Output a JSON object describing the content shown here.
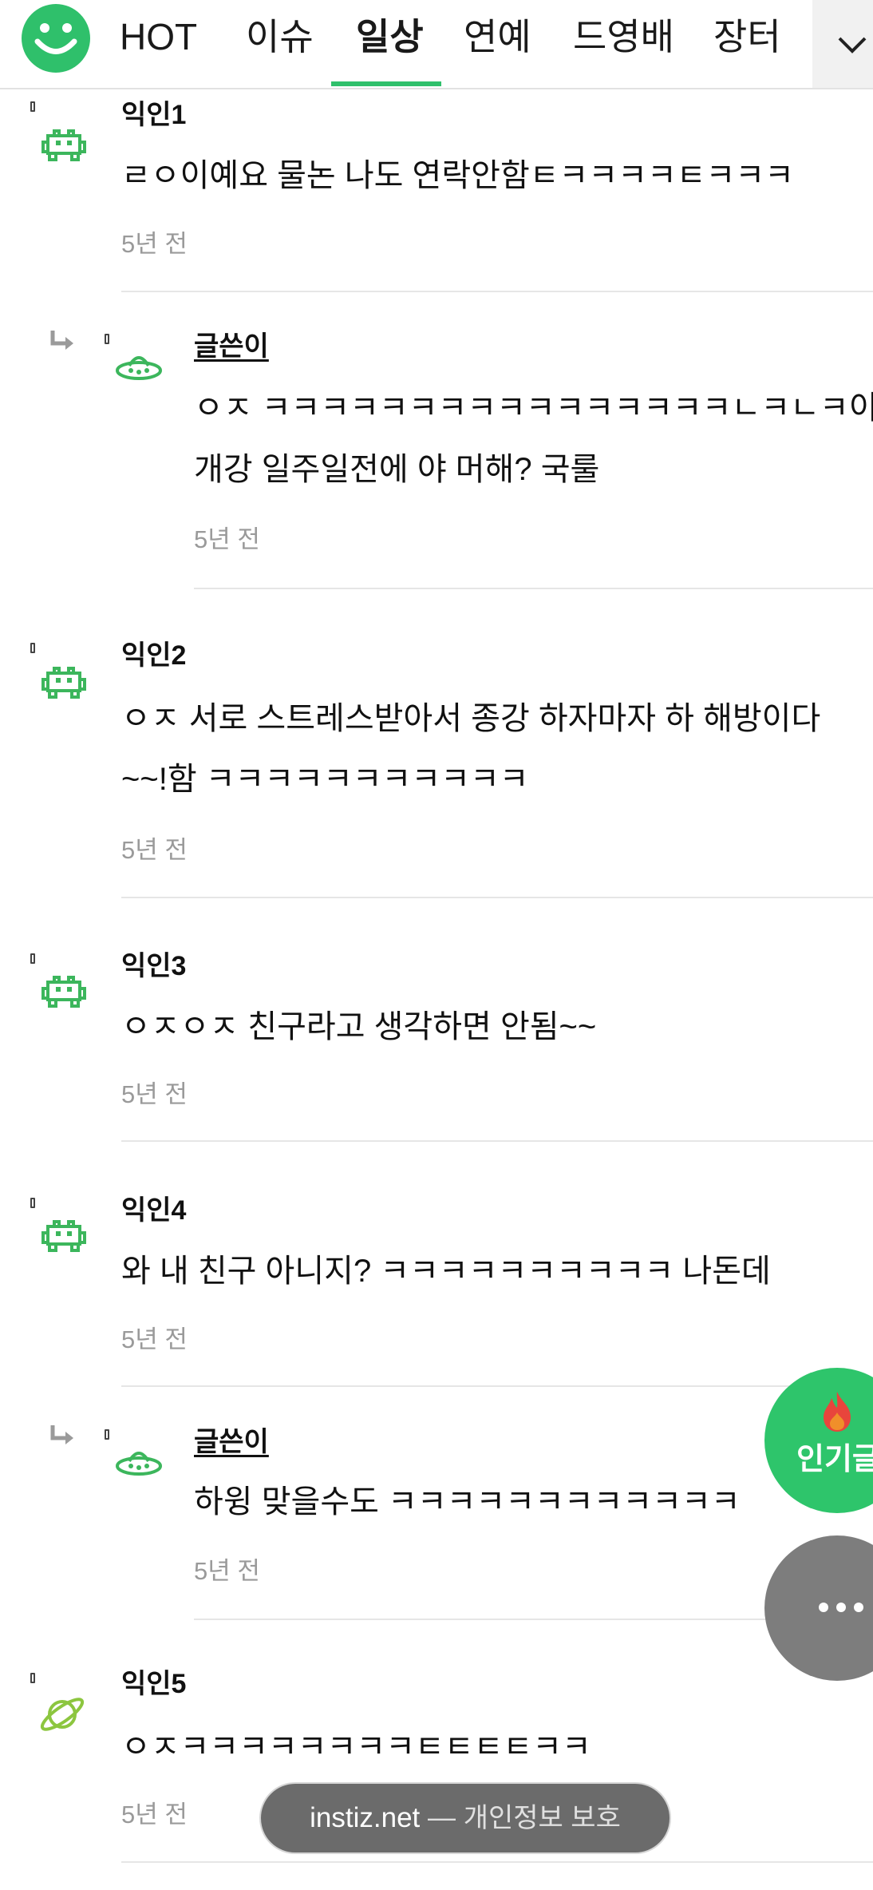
{
  "colors": {
    "brand_green": "#2fc06b",
    "icon_green": "#3cb65c",
    "planet_green": "#8cc63f",
    "timestamp_gray": "#9a9a9a",
    "fab_gray": "#7d7d7d"
  },
  "header": {
    "logo_icon": "smiley-logo-icon",
    "tabs": [
      {
        "label": "HOT",
        "active": false
      },
      {
        "label": "이슈",
        "active": false
      },
      {
        "label": "일상",
        "active": true
      },
      {
        "label": "연예",
        "active": false
      },
      {
        "label": "드영배",
        "active": false
      },
      {
        "label": "장터",
        "active": false
      }
    ],
    "more_icon": "chevron-down-icon"
  },
  "comments": [
    {
      "author": "익인1",
      "is_reply": false,
      "is_op": false,
      "avatar": "invader-icon",
      "lines": [
        "ㄹㅇ이예요 물논 나도 연락안함ㅌㅋㅋㅋㅋㅌㅋㅋㅋ"
      ],
      "time": "5년 전"
    },
    {
      "author": "글쓴이",
      "is_reply": true,
      "is_op": true,
      "avatar": "ufo-icon",
      "lines": [
        "ㅇㅈ ㅋㅋㅋㅋㅋㅋㅋㅋㅋㅋㅋㅋㅋㅋㅋㅋㄴㅋㄴㅋ이제 한",
        "개강 일주일전에 야 머해? 국룰"
      ],
      "time": "5년 전"
    },
    {
      "author": "익인2",
      "is_reply": false,
      "is_op": false,
      "avatar": "invader-icon",
      "lines": [
        "ㅇㅈ 서로 스트레스받아서 종강 하자마자 하 해방이다",
        "~~!함 ㅋㅋㅋㅋㅋㅋㅋㅋㅋㅋㅋ"
      ],
      "time": "5년 전"
    },
    {
      "author": "익인3",
      "is_reply": false,
      "is_op": false,
      "avatar": "invader-icon",
      "lines": [
        "ㅇㅈㅇㅈ 친구라고 생각하면 안됨~~"
      ],
      "time": "5년 전"
    },
    {
      "author": "익인4",
      "is_reply": false,
      "is_op": false,
      "avatar": "invader-icon",
      "lines": [
        "와 내 친구 아니지? ㅋㅋㅋㅋㅋㅋㅋㅋㅋㅋ 나돈데"
      ],
      "time": "5년 전"
    },
    {
      "author": "글쓴이",
      "is_reply": true,
      "is_op": true,
      "avatar": "ufo-icon",
      "lines": [
        "하윙 맞을수도 ㅋㅋㅋㅋㅋㅋㅋㅋㅋㅋㅋㅋ"
      ],
      "time": "5년 전"
    },
    {
      "author": "익인5",
      "is_reply": false,
      "is_op": false,
      "avatar": "planet-icon",
      "lines": [
        "ㅇㅈㅋㅋㅋㅋㅋㅋㅋㅋㅌㅌㅌㅌㅋㅋ"
      ],
      "time": "5년 전"
    }
  ],
  "fab": {
    "popular_label": "인기글",
    "popular_icon": "fire-icon",
    "more_icon": "more-dots-icon"
  },
  "toast": {
    "domain": "instiz.net",
    "separator": " — ",
    "privacy": "개인정보 보호"
  }
}
